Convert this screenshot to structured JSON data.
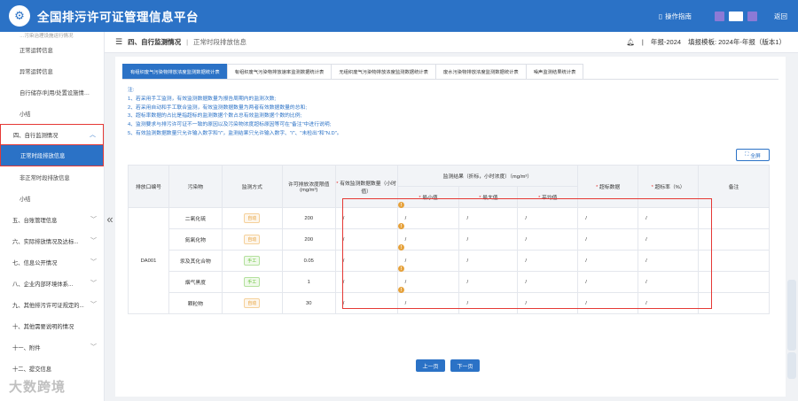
{
  "header": {
    "title": "全国排污许可证管理信息平台",
    "help": "操作指南",
    "back": "返回",
    "colors": {
      "sq1": "#8c7ad6",
      "sq2": "#ffffff",
      "sq3": "#8c7ad6"
    }
  },
  "sidebar": {
    "cut_top": "…污染治理设施运行情况",
    "items_top": [
      "正常运转信息",
      "异常运转信息",
      "自行储存/利用/处置设施情…",
      "小结"
    ],
    "group": "四、自行监测情况",
    "active": "正常时段排放信息",
    "items_mid": [
      "非正常时段排放信息",
      "小结"
    ],
    "items_bottom": [
      "五、台账管理信息",
      "六、实际排放情况及达标...",
      "七、信息公开情况",
      "八、企业内部环境体系...",
      "九、其他排污许可证规定的...",
      "十、其他需要说明的情况",
      "十一、附件",
      "十二、提交信息"
    ]
  },
  "topbar": {
    "title": "四、自行监测情况",
    "sub": "正常时段排放信息",
    "year": "年报-2024",
    "template_label": "填报模板:",
    "template": "2024年-年报（版本1）"
  },
  "tabs": [
    "有组织废气污染物排放浓度监测数据统计表",
    "有组织废气污染物排放速率监测数据统计表",
    "无组织废气污染物排放浓度监测数据统计表",
    "废水污染物排放浓度监测数据统计表",
    "噪声监测结果统计表"
  ],
  "notes": {
    "title": "注:",
    "lines": [
      "1、若采用手工监测，有效监测数据数量为报告周期内的监测次数;",
      "2、若采用自动和手工联合监测，有效监测数据数量为两者有效数据数量的总和;",
      "3、超标率数据的占比是指超标的监测数据个数占总有效监测数据个数的比例;",
      "4、监测要求与排污许可证不一致的原因以及污染物浓度超标原因等可在\"备注\"中进行说明;",
      "5、有效监测数据数量只允许输入数字和\"/\"，监测结果只允许输入数字、\"/\"、\"未检出\"和\"N.D\"。"
    ]
  },
  "fullscreen": "全屏",
  "table": {
    "headers": {
      "outlet": "排放口编号",
      "pollutant": "污染物",
      "method": "监测方式",
      "limit": "许可排放浓度限值(mg/m³)",
      "valid": "有效监测数据数量（小时值）",
      "result": "监测结果（折标，小时浓度）（mg/m³）",
      "min": "最小值",
      "max": "最大值",
      "avg": "平均值",
      "exceed_count": "超标数据",
      "exceed_rate": "超标率（%）",
      "remark": "备注",
      "star": "*"
    },
    "outlet": "DA001",
    "rows": [
      {
        "pollutant": "二氧化硫",
        "method": "自动",
        "limit": "200",
        "valid": "/",
        "min": "/",
        "max": "/",
        "avg": "/",
        "cnt": "/",
        "rate": "/"
      },
      {
        "pollutant": "氮氧化物",
        "method": "自动",
        "limit": "200",
        "valid": "/",
        "min": "/",
        "max": "/",
        "avg": "/",
        "cnt": "/",
        "rate": "/"
      },
      {
        "pollutant": "汞及其化合物",
        "method": "手工",
        "limit": "0.05",
        "valid": "/",
        "min": "/",
        "max": "/",
        "avg": "/",
        "cnt": "/",
        "rate": "/"
      },
      {
        "pollutant": "烟气黑度",
        "method": "手工",
        "limit": "1",
        "valid": "/",
        "min": "/",
        "max": "/",
        "avg": "/",
        "cnt": "/",
        "rate": "/"
      },
      {
        "pollutant": "颗粒物",
        "method": "自动",
        "limit": "30",
        "valid": "/",
        "min": "/",
        "max": "/",
        "avg": "/",
        "cnt": "/",
        "rate": "/"
      }
    ]
  },
  "pager": {
    "prev": "上一页",
    "next": "下一页"
  },
  "watermark": "大数跨境"
}
